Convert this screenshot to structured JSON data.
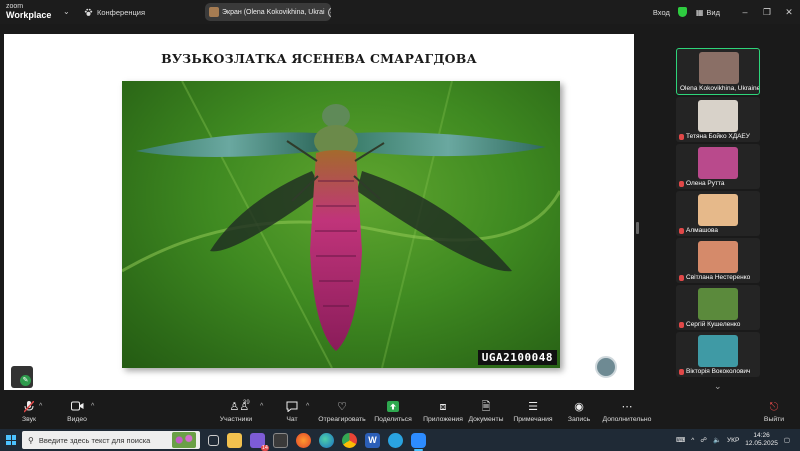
{
  "app": {
    "logo_line1": "zoom",
    "logo_line2": "Workplace"
  },
  "topbar": {
    "conference_label": "Конференция",
    "share_label": "Экран (Olena Kokovikhina, Ukrai",
    "login_label": "Вход",
    "view_label": "Вид"
  },
  "slide": {
    "title": "ВУЗЬКОЗЛАТКА ЯСЕНЕВА СМАРАГДОВА",
    "image_watermark": "UGA2100048"
  },
  "participants": [
    {
      "name": "Olena Kokovikhina, Ukraine",
      "active": true,
      "muted": false,
      "photo_color": "#8a6f66"
    },
    {
      "name": "Тетяна Бойко ХДАЕУ",
      "active": false,
      "muted": true,
      "photo_color": "#d8d2c9"
    },
    {
      "name": "Олена Рутта",
      "active": false,
      "muted": true,
      "photo_color": "#b94a8c"
    },
    {
      "name": "Алмашова",
      "active": false,
      "muted": true,
      "photo_color": "#e6b98a"
    },
    {
      "name": "Світлана Нестеренко",
      "active": false,
      "muted": true,
      "photo_color": "#d58a6a"
    },
    {
      "name": "Сергій Кушеленко",
      "active": false,
      "muted": true,
      "photo_color": "#5b8a3c"
    },
    {
      "name": "Вікторія Вококолович",
      "active": false,
      "muted": true,
      "photo_color": "#3f9aa5"
    }
  ],
  "toolbar": {
    "audio": "Звук",
    "video": "Видео",
    "participants": "Участники",
    "participants_count": "39",
    "chat": "Чат",
    "react": "Отреагировать",
    "share": "Поделиться",
    "apps": "Приложения",
    "docs": "Документы",
    "notes": "Примечания",
    "record": "Запись",
    "more": "Дополнительно",
    "leave": "Выйти"
  },
  "taskbar": {
    "search_placeholder": "Введите здесь текст для поиска",
    "language": "УКР",
    "time": "14:26",
    "date": "12.05.2025",
    "chat_badge": "14"
  },
  "colors": {
    "accent_green": "#2ed47a",
    "mute_red": "#e04848",
    "share_green": "#2ea84f"
  }
}
